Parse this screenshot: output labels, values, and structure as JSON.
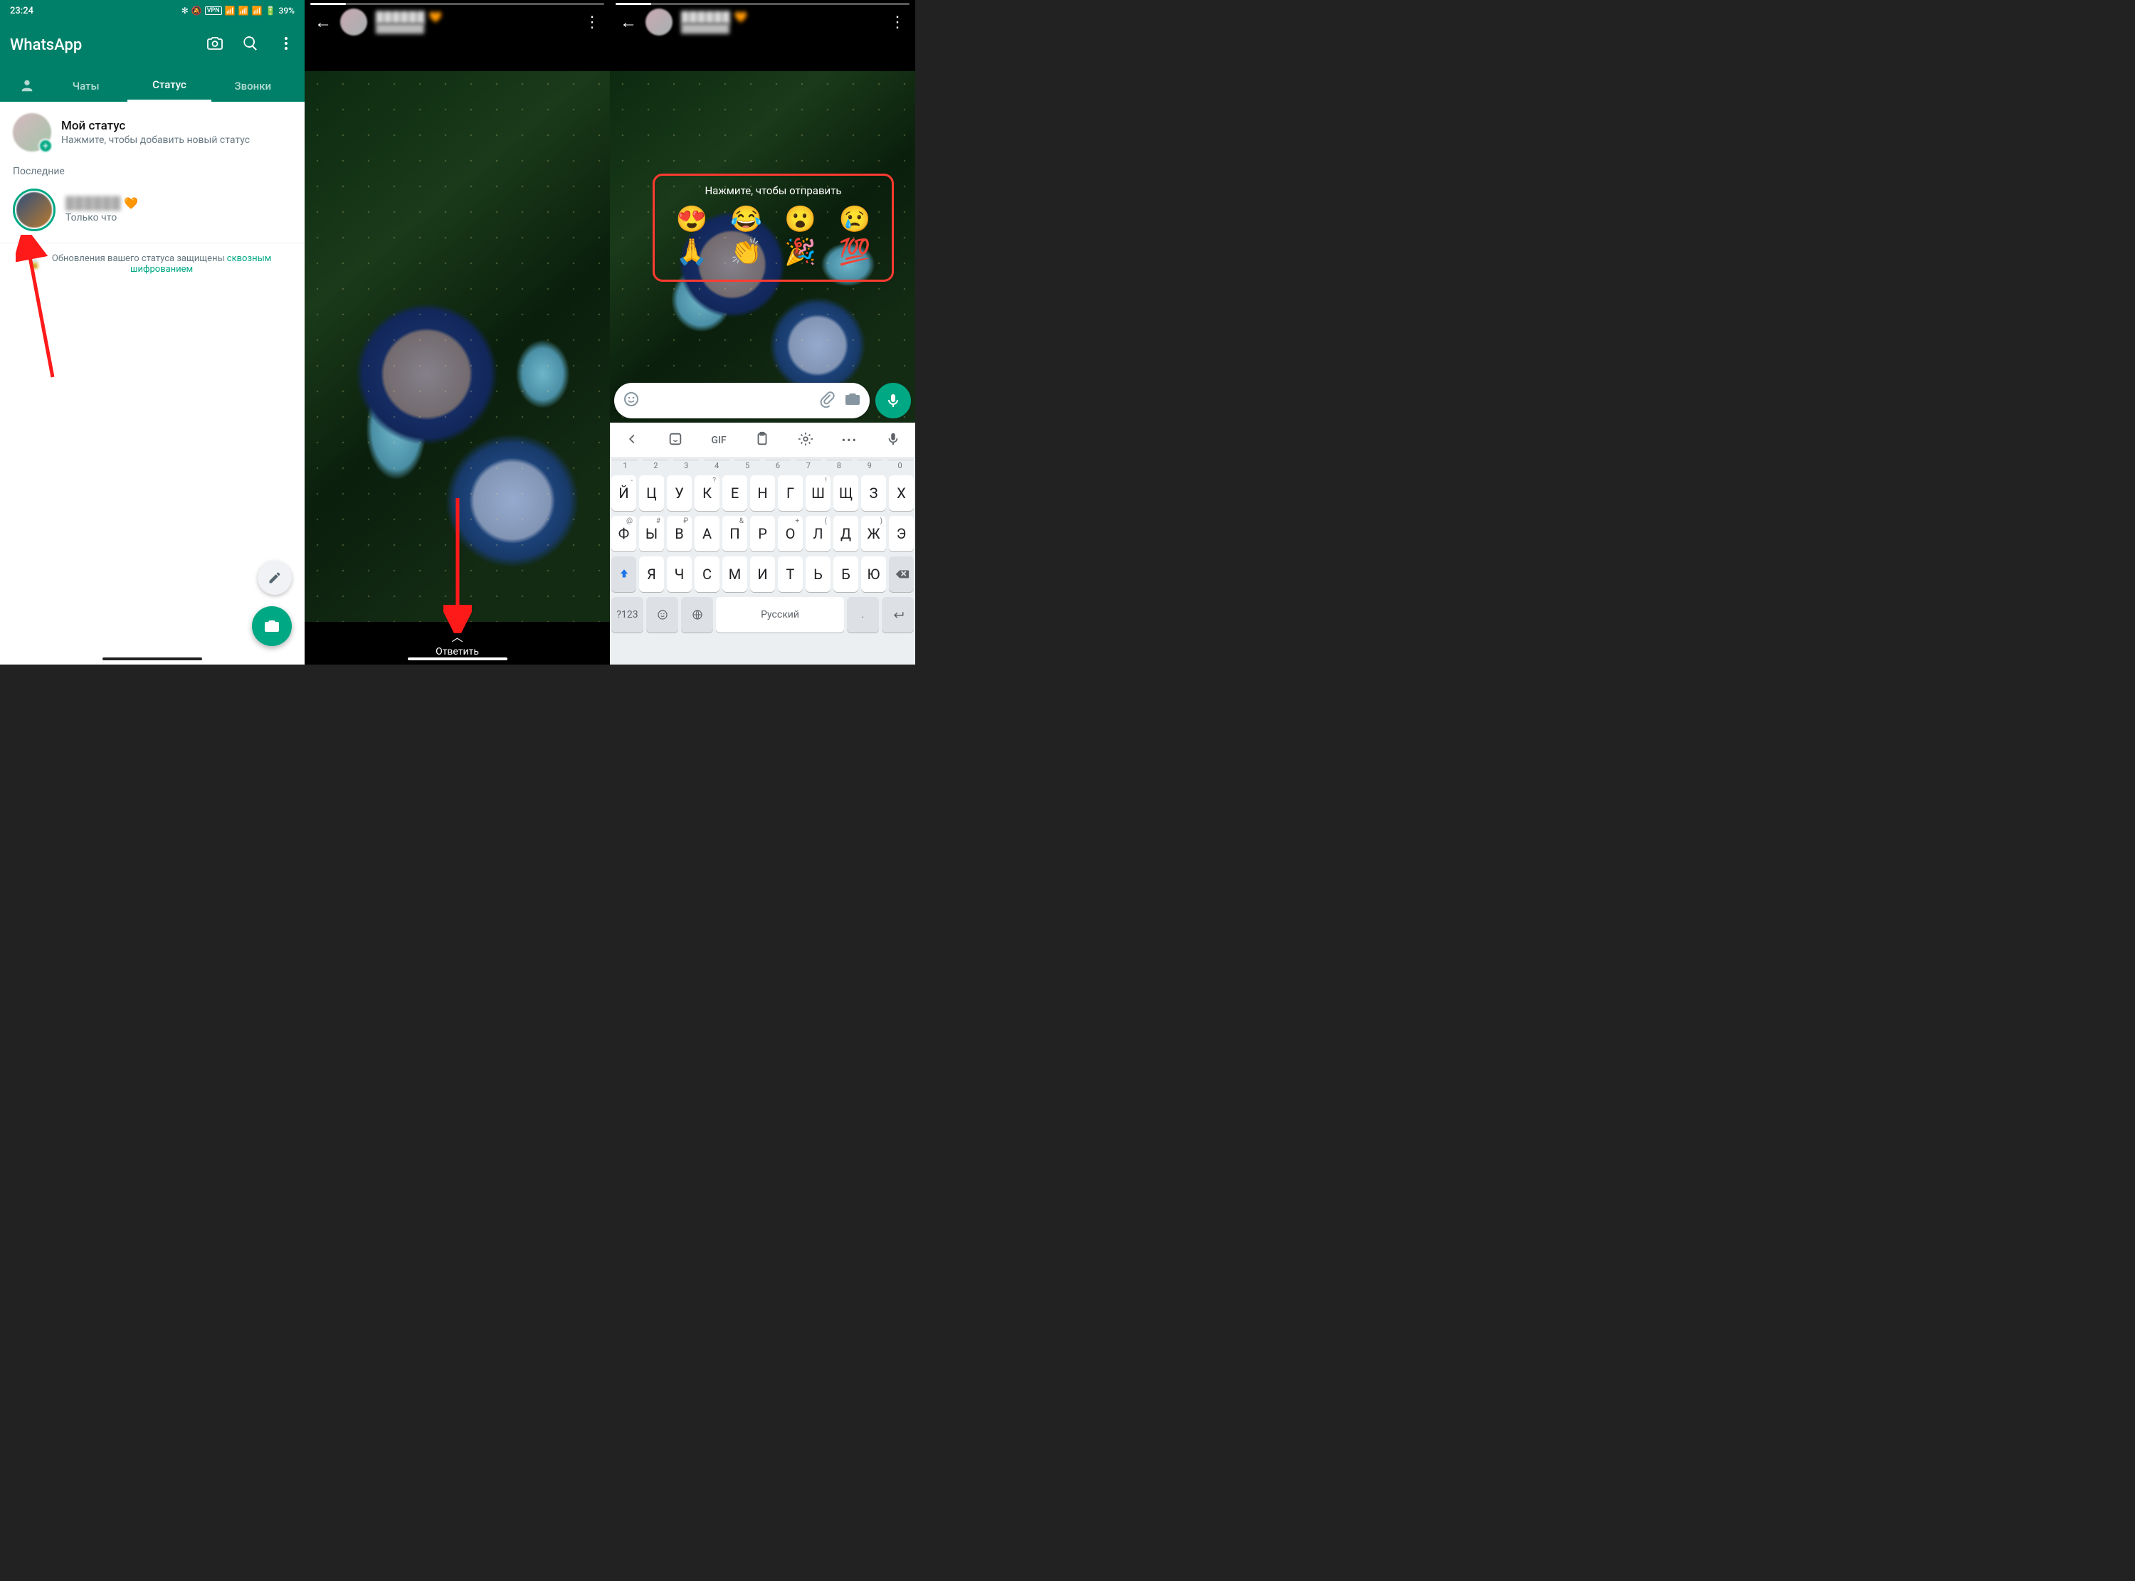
{
  "screen1": {
    "statusbar": {
      "time": "23:24",
      "battery": "39%",
      "vpn": "VPN"
    },
    "app_title": "WhatsApp",
    "tabs": {
      "chats": "Чаты",
      "status": "Статус",
      "calls": "Звонки"
    },
    "my_status": {
      "title": "Мой статус",
      "subtitle": "Нажмите, чтобы добавить новый статус"
    },
    "recent_label": "Последние",
    "recent_item": {
      "time": "Только что"
    },
    "encryption": {
      "text_prefix": "Обновления вашего статуса защищены ",
      "link": "сквозным шифрованием"
    }
  },
  "screen2": {
    "reply": "Ответить"
  },
  "screen3": {
    "reactions": {
      "prompt": "Нажмите, чтобы отправить",
      "row1": [
        "😍",
        "😂",
        "😮",
        "😢"
      ],
      "row2": [
        "🙏",
        "👏",
        "🎉",
        "💯"
      ]
    },
    "keyboard": {
      "top": {
        "gif": "GIF"
      },
      "numbers_primary": [
        "1",
        "2",
        "3",
        "4",
        "5",
        "6",
        "7",
        "8",
        "9",
        "0"
      ],
      "row1_hints": [
        "-",
        "",
        "",
        "?",
        "",
        "",
        "",
        "!",
        "",
        ""
      ],
      "row1": [
        "Й",
        "Ц",
        "У",
        "К",
        "Е",
        "Н",
        "Г",
        "Ш",
        "Щ",
        "З",
        "Х"
      ],
      "row2_hints": [
        "@",
        "#",
        "₽",
        "",
        "&",
        "",
        "+",
        "(",
        "",
        ")",
        ""
      ],
      "row2": [
        "Ф",
        "Ы",
        "В",
        "А",
        "П",
        "Р",
        "О",
        "Л",
        "Д",
        "Ж",
        "Э"
      ],
      "row3": [
        "Я",
        "Ч",
        "С",
        "М",
        "И",
        "Т",
        "Ь",
        "Б",
        "Ю"
      ],
      "bottom": {
        "sym": "?123",
        "space": "Русский",
        "dot": "."
      }
    }
  }
}
